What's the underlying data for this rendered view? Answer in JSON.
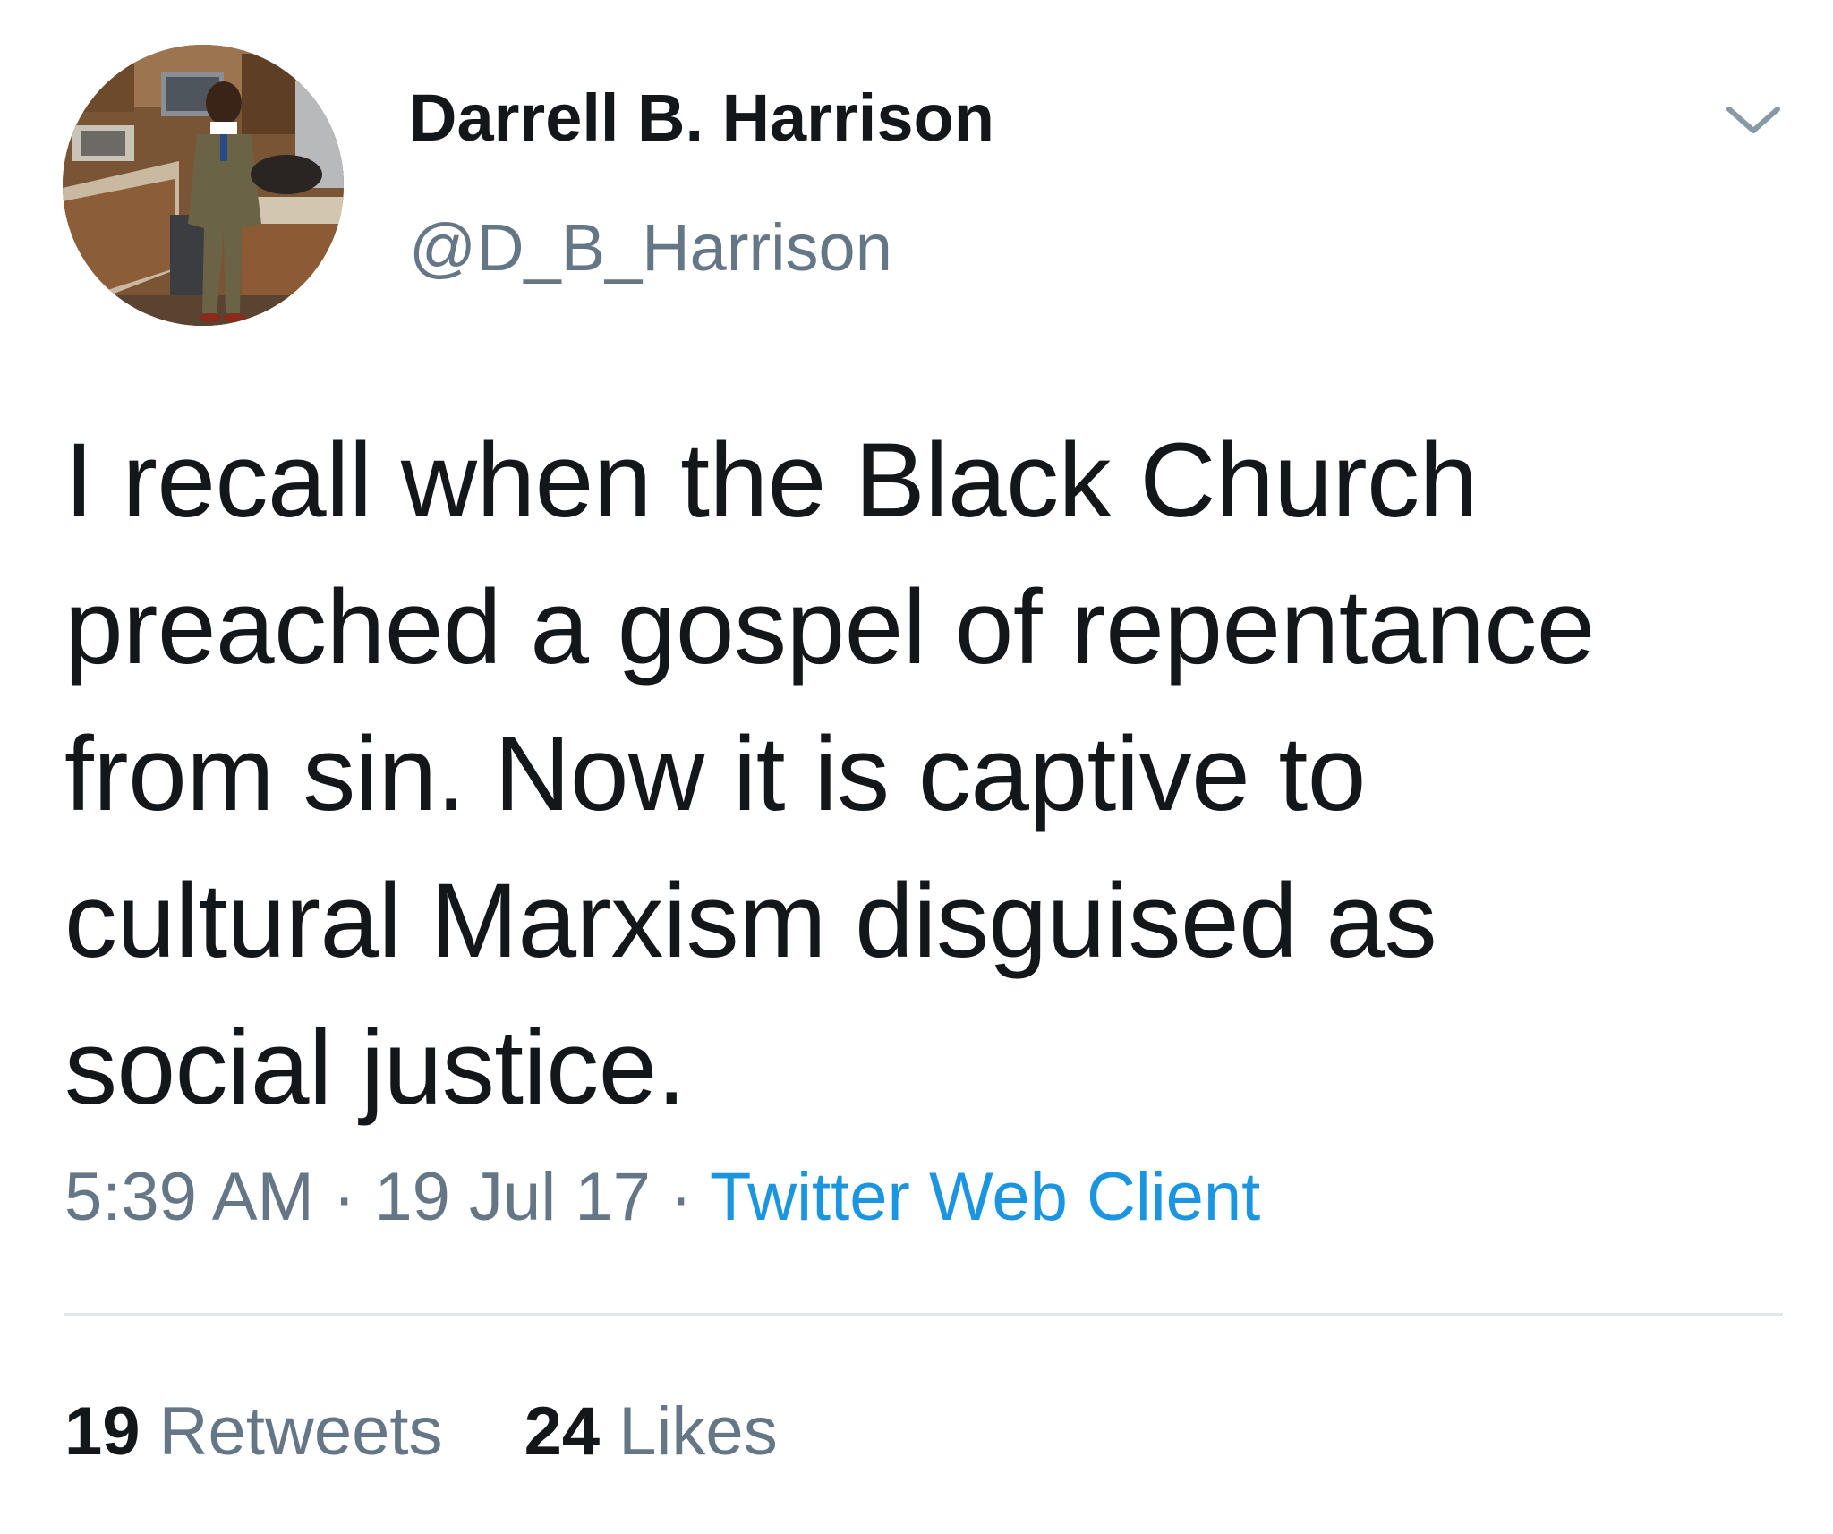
{
  "user": {
    "display_name": "Darrell B. Harrison",
    "handle": "@D_B_Harrison",
    "avatar_icon": "profile-photo"
  },
  "menu": {
    "icon": "chevron-down-icon"
  },
  "tweet": {
    "lines": [
      "I recall when the Black Church",
      "preached a gospel of repentance",
      "from sin. Now it is captive to",
      "cultural Marxism disguised as",
      "social justice."
    ]
  },
  "meta": {
    "time": "5:39 AM",
    "separator": "·",
    "date": "19 Jul 17",
    "source": "Twitter Web Client"
  },
  "stats": {
    "retweets_count": "19",
    "retweets_label": "Retweets",
    "likes_count": "24",
    "likes_label": "Likes"
  },
  "colors": {
    "text_primary": "#14171a",
    "text_secondary": "#657786",
    "link": "#1b95e0",
    "divider": "#e1e8ed"
  }
}
